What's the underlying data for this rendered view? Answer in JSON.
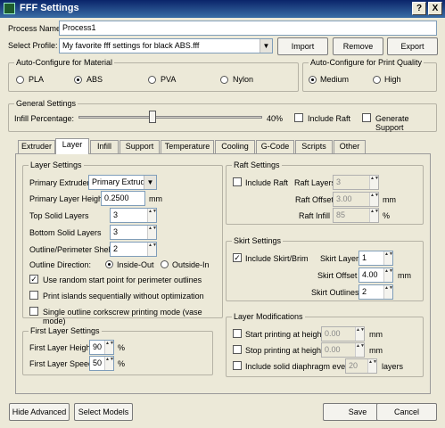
{
  "window": {
    "title": "FFF Settings",
    "help": "?",
    "close": "X"
  },
  "process": {
    "label": "Process Name:",
    "value": "Process1"
  },
  "profile": {
    "label": "Select Profile:",
    "value": "My favorite fff settings for black ABS.fff",
    "import": "Import",
    "remove": "Remove",
    "export": "Export"
  },
  "material": {
    "title": "Auto-Configure for Material",
    "options": [
      "PLA",
      "ABS",
      "PVA",
      "Nylon"
    ],
    "selected": "ABS"
  },
  "quality": {
    "title": "Auto-Configure for Print Quality",
    "options": [
      "Medium",
      "High"
    ],
    "selected": "Medium"
  },
  "general": {
    "title": "General Settings",
    "infill_label": "Infill Percentage:",
    "infill_value": "40%",
    "infill_fraction": 0.4,
    "include_raft": "Include Raft",
    "generate_support": "Generate Support"
  },
  "tabs": [
    "Extruder",
    "Layer",
    "Infill",
    "Support",
    "Temperature",
    "Cooling",
    "G-Code",
    "Scripts",
    "Other"
  ],
  "active_tab": "Layer",
  "layer_settings": {
    "title": "Layer Settings",
    "primary_extruder_label": "Primary Extruder",
    "primary_extruder_value": "Primary Extruder",
    "primary_layer_height_label": "Primary Layer Height",
    "primary_layer_height_value": "0.2500",
    "primary_layer_height_unit": "mm",
    "top_solid_label": "Top Solid Layers",
    "top_solid_value": "3",
    "bottom_solid_label": "Bottom Solid Layers",
    "bottom_solid_value": "3",
    "shells_label": "Outline/Perimeter Shells",
    "shells_value": "2",
    "outline_direction_label": "Outline Direction:",
    "inside_out": "Inside-Out",
    "outside_in": "Outside-In",
    "random_start": "Use random start point for perimeter outlines",
    "print_islands": "Print islands sequentially without optimization",
    "vase_mode": "Single outline corkscrew printing mode (vase mode)"
  },
  "first_layer": {
    "title": "First Layer Settings",
    "height_label": "First Layer Height",
    "height_value": "90",
    "speed_label": "First Layer Speed",
    "speed_value": "50",
    "unit": "%"
  },
  "raft": {
    "title": "Raft Settings",
    "include": "Include Raft",
    "layers_label": "Raft Layers",
    "layers_value": "3",
    "offset_label": "Raft Offset",
    "offset_value": "3.00",
    "offset_unit": "mm",
    "infill_label": "Raft Infill",
    "infill_value": "85",
    "infill_unit": "%"
  },
  "skirt": {
    "title": "Skirt Settings",
    "include": "Include Skirt/Brim",
    "layers_label": "Skirt Layers",
    "layers_value": "1",
    "offset_label": "Skirt Offset",
    "offset_value": "4.00",
    "offset_unit": "mm",
    "outlines_label": "Skirt Outlines",
    "outlines_value": "2"
  },
  "modifications": {
    "title": "Layer Modifications",
    "start_label": "Start printing at height",
    "start_value": "0.00",
    "stop_label": "Stop printing at height",
    "stop_value": "0.00",
    "unit": "mm",
    "diaphragm_label": "Include solid diaphragm every",
    "diaphragm_value": "20",
    "diaphragm_unit": "layers"
  },
  "footer": {
    "hide_advanced": "Hide Advanced",
    "select_models": "Select Models",
    "save": "Save",
    "cancel": "Cancel"
  },
  "check_mark": "✓",
  "spin_glyph": "▲▼"
}
